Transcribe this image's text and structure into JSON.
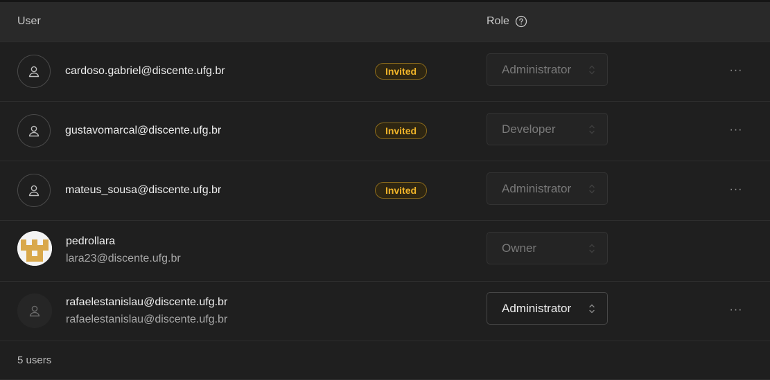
{
  "header": {
    "user_label": "User",
    "role_label": "Role",
    "help_icon": "question-circle-icon"
  },
  "users": [
    {
      "primary": "cardoso.gabriel@discente.ufg.br",
      "secondary": "",
      "badge": "Invited",
      "role": "Administrator",
      "role_enabled": false,
      "avatar": "user-placeholder-icon",
      "has_menu": true
    },
    {
      "primary": "gustavomarcal@discente.ufg.br",
      "secondary": "",
      "badge": "Invited",
      "role": "Developer",
      "role_enabled": false,
      "avatar": "user-placeholder-icon",
      "has_menu": true
    },
    {
      "primary": "mateus_sousa@discente.ufg.br",
      "secondary": "",
      "badge": "Invited",
      "role": "Administrator",
      "role_enabled": false,
      "avatar": "user-placeholder-icon",
      "has_menu": true
    },
    {
      "primary": "pedrollara",
      "secondary": "lara23@discente.ufg.br",
      "badge": "",
      "role": "Owner",
      "role_enabled": false,
      "avatar": "identicon-image",
      "has_menu": false
    },
    {
      "primary": "rafaelestanislau@discente.ufg.br",
      "secondary": "rafaelestanislau@discente.ufg.br",
      "badge": "",
      "role": "Administrator",
      "role_enabled": true,
      "avatar": "user-placeholder-icon",
      "has_menu": true
    }
  ],
  "more_glyph": "···",
  "footer": {
    "count_label": "5 users"
  },
  "colors": {
    "background": "#1f1f1f",
    "header_bg": "#292929",
    "badge_text": "#f0b429",
    "identicon": "#d9a84a"
  }
}
